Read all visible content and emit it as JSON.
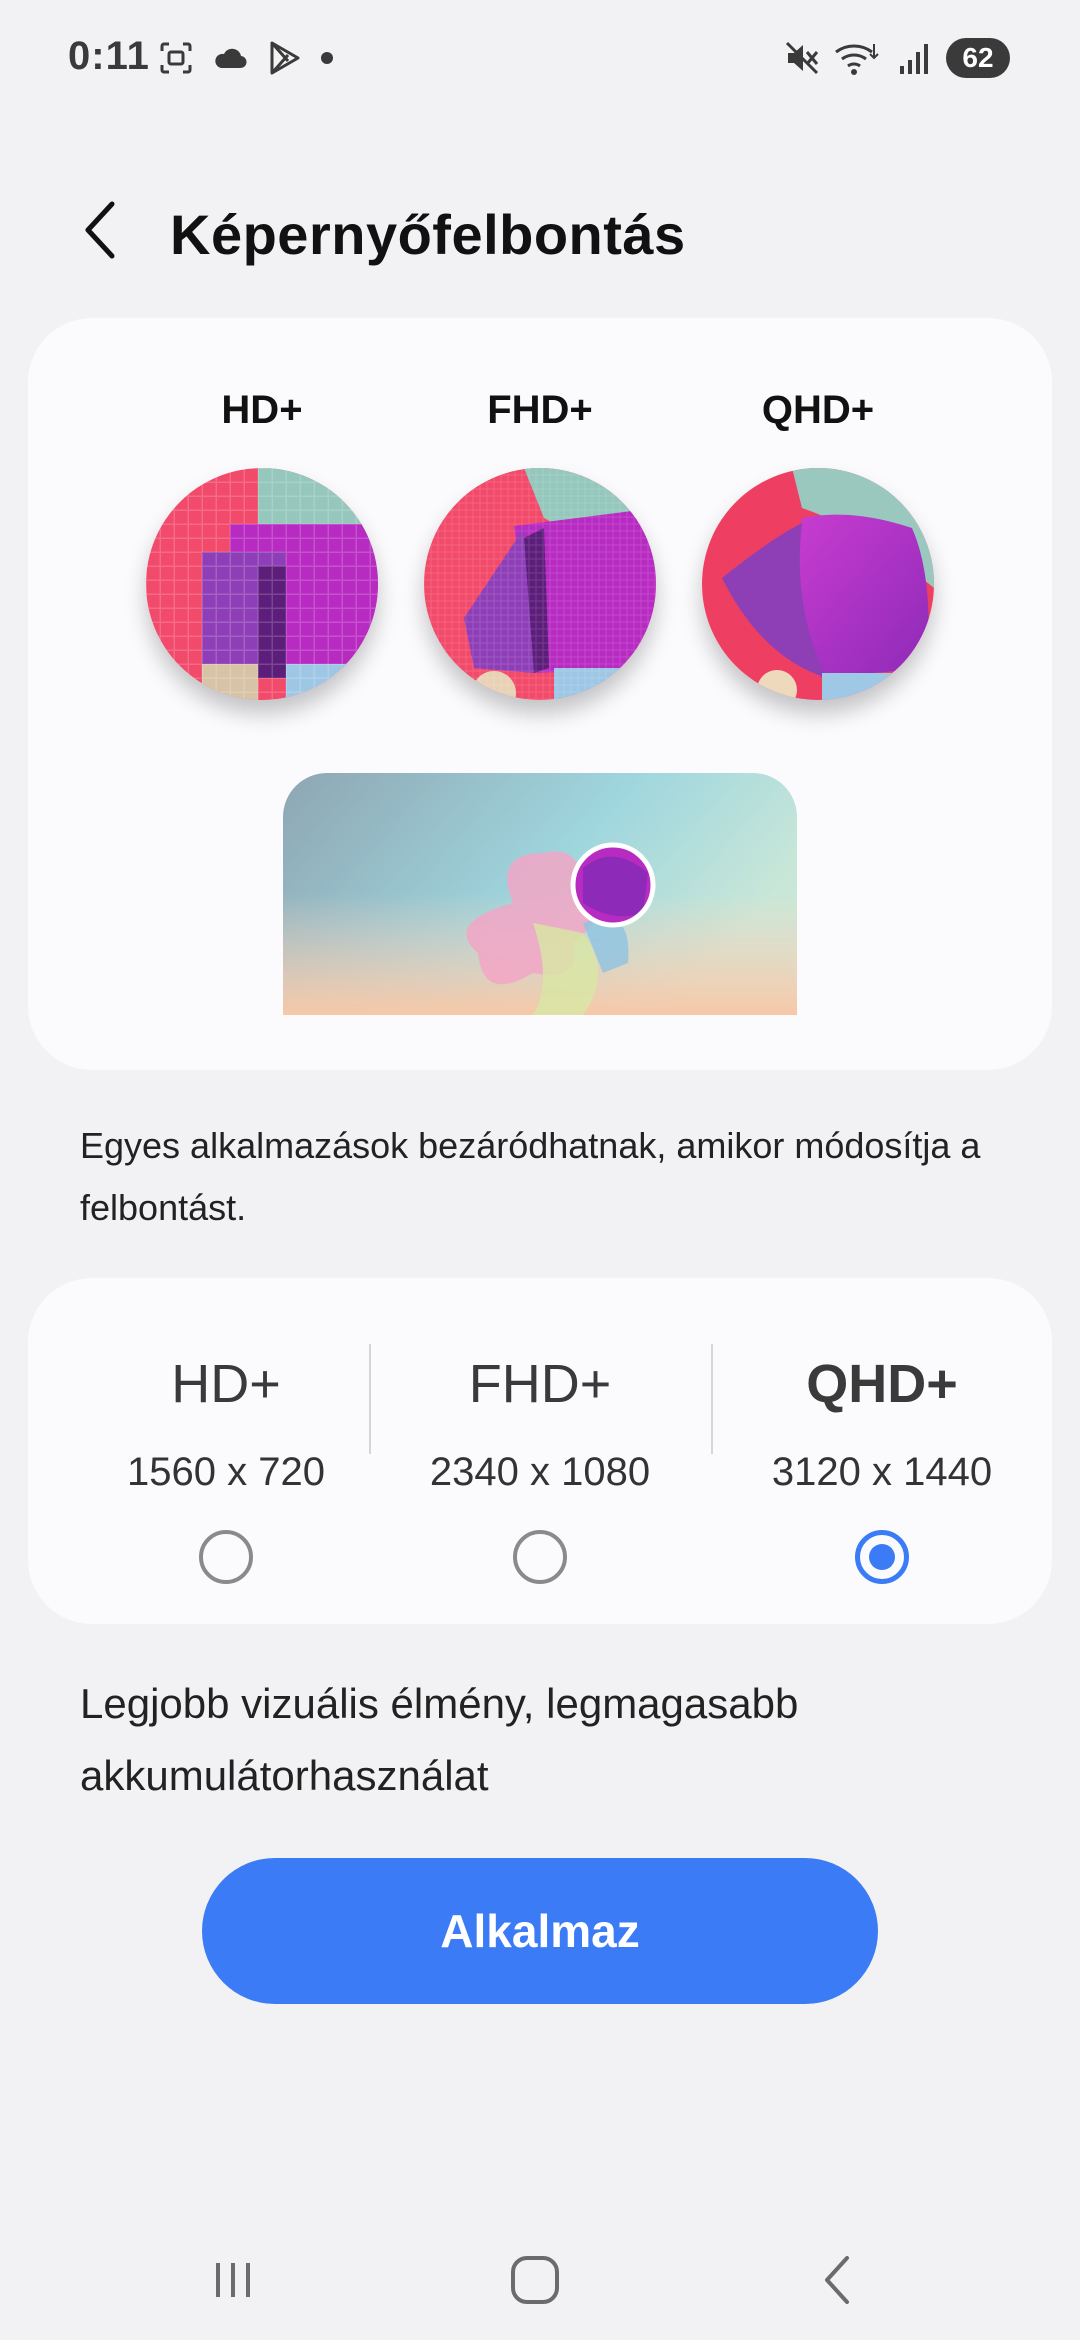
{
  "status_bar": {
    "time": "0:11",
    "battery": "62",
    "left_icons": [
      "screenshot-icon",
      "cloud-icon",
      "play-store-icon",
      "dot-icon"
    ],
    "right_icons": [
      "mute-icon",
      "wifi-icon",
      "signal-icon"
    ]
  },
  "header": {
    "title": "Képernyőfelbontás",
    "back_icon": "chevron-left-icon"
  },
  "preview": {
    "labels": [
      "HD+",
      "FHD+",
      "QHD+"
    ]
  },
  "warning_text": "Egyes alkalmazások bezáródhatnak, amikor módosítja a felbontást.",
  "resolutions": [
    {
      "name": "HD+",
      "value": "1560 x 720",
      "selected": false
    },
    {
      "name": "FHD+",
      "value": "2340 x 1080",
      "selected": false
    },
    {
      "name": "QHD+",
      "value": "3120 x 1440",
      "selected": true
    }
  ],
  "detail_text": "Legjobb vizuális élmény, legmagasabb akkumulátorhasználat",
  "apply_button": "Alkalmaz",
  "nav_bar": {
    "items": [
      "recent-apps-icon",
      "home-icon",
      "back-icon"
    ]
  },
  "colors": {
    "accent": "#3b7cf6",
    "background": "#f2f2f4",
    "card": "#fbfbfd"
  }
}
